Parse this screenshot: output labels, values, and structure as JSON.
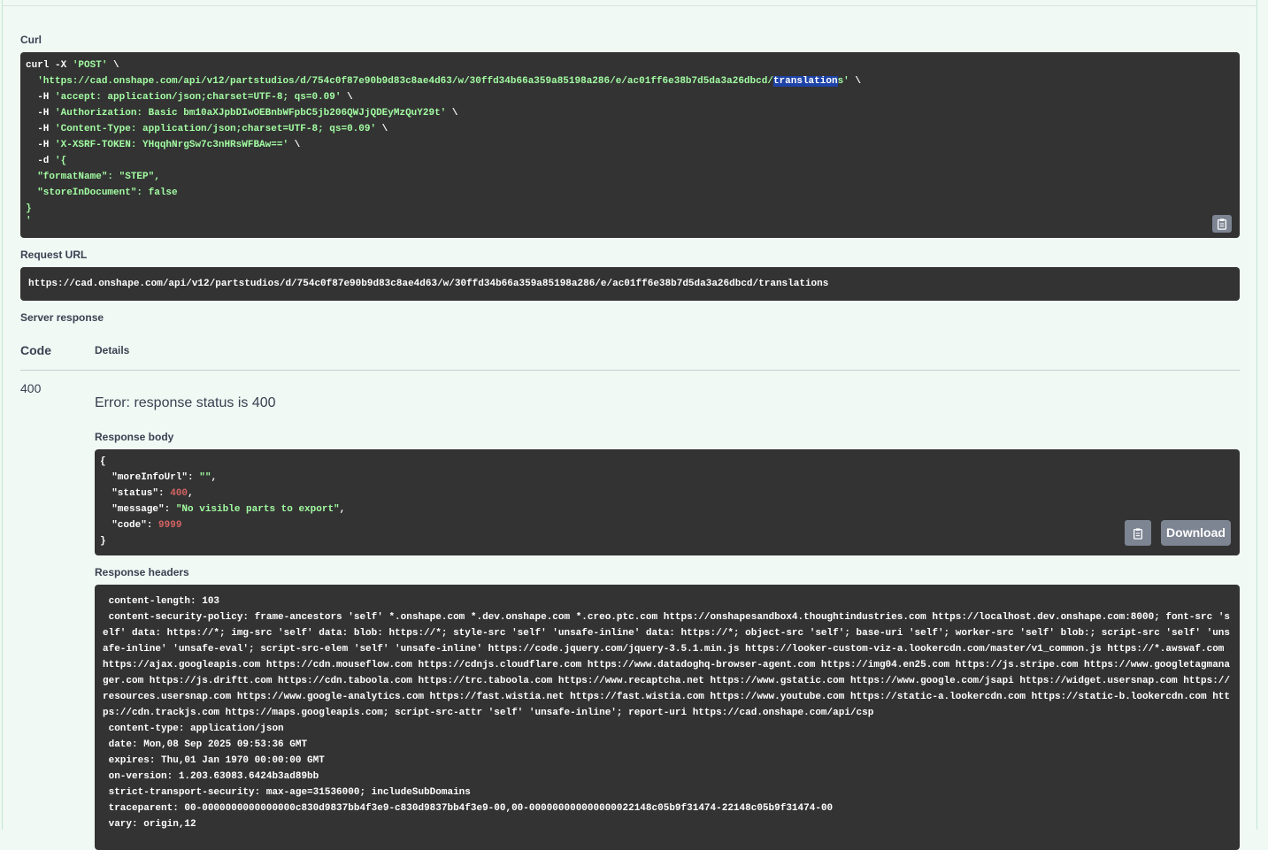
{
  "curl": {
    "label": "Curl",
    "line1": "curl -X ",
    "method": "'POST'",
    "cont": " \\",
    "url_pre": "  'https://cad.onshape.com/api/v12/partstudios/d/754c0f87e90b9d83c8ae4d63/w/30ffd34b66a359a85198a286/e/ac01ff6e38b7d5da3a26dbcd/",
    "url_hl": "translation",
    "url_post": "s'",
    "h1_flag": "  -H ",
    "h1": "'accept: application/json;charset=UTF-8; qs=0.09'",
    "h2_flag": "  -H ",
    "h2": "'Authorization: Basic bm10aXJpbDIwOEBnbWFpbC5jb206QWJjQDEyMzQuY29t'",
    "h3_flag": "  -H ",
    "h3": "'Content-Type: application/json;charset=UTF-8; qs=0.09'",
    "h4_flag": "  -H ",
    "h4": "'X-XSRF-TOKEN: YHqqhNrgSw7c3nHRsWFBAw=='",
    "d_flag": "  -d ",
    "d_open": "'{",
    "b1": "  \"formatName\": \"STEP\",",
    "b2": "  \"storeInDocument\": false",
    "b3": "}",
    "b4": "'"
  },
  "request_url": {
    "label": "Request URL",
    "value": "https://cad.onshape.com/api/v12/partstudios/d/754c0f87e90b9d83c8ae4d63/w/30ffd34b66a359a85198a286/e/ac01ff6e38b7d5da3a26dbcd/translations"
  },
  "server_response": {
    "label": "Server response",
    "col_code": "Code",
    "col_details": "Details",
    "code": "400",
    "error": "Error: response status is 400",
    "body_label": "Response body",
    "body": {
      "open": "{",
      "k1": "  \"moreInfoUrl\"",
      "v1": "\"\"",
      "k2": "  \"status\"",
      "v2": "400",
      "k3": "  \"message\"",
      "v3": "\"No visible parts to export\"",
      "k4": "  \"code\"",
      "v4": "9999",
      "close": "}"
    },
    "download": "Download",
    "headers_label": "Response headers",
    "headers": [
      " content-length: 103",
      " content-security-policy: frame-ancestors 'self' *.onshape.com *.dev.onshape.com *.creo.ptc.com https://onshapesandbox4.thoughtindustries.com https://localhost.dev.onshape.com:8000; font-src 'self' data: https://*; img-src 'self' data: blob: https://*; style-src 'self' 'unsafe-inline' data: https://*; object-src 'self'; base-uri 'self'; worker-src 'self' blob:; script-src 'self' 'unsafe-inline' 'unsafe-eval'; script-src-elem 'self' 'unsafe-inline' https://code.jquery.com/jquery-3.5.1.min.js https://looker-custom-viz-a.lookercdn.com/master/v1_common.js https://*.awswaf.com https://ajax.googleapis.com https://cdn.mouseflow.com https://cdnjs.cloudflare.com https://www.datadoghq-browser-agent.com https://img04.en25.com https://js.stripe.com https://www.googletagmanager.com https://js.driftt.com https://cdn.taboola.com https://trc.taboola.com https://www.recaptcha.net https://www.gstatic.com https://www.google.com/jsapi https://widget.usersnap.com https://resources.usersnap.com https://www.google-analytics.com https://fast.wistia.net https://fast.wistia.com https://www.youtube.com https://static-a.lookercdn.com https://static-b.lookercdn.com https://cdn.trackjs.com https://maps.googleapis.com; script-src-attr 'self' 'unsafe-inline'; report-uri https://cad.onshape.com/api/csp",
      " content-type: application/json",
      " date: Mon,08 Sep 2025 09:53:36 GMT",
      " expires: Thu,01 Jan 1970 00:00:00 GMT",
      " on-version: 1.203.63083.6424b3ad89bb",
      " strict-transport-security: max-age=31536000; includeSubDomains",
      " traceparent: 00-0000000000000000c830d9837bb4f3e9-c830d9837bb4f3e9-00,00-000000000000000022148c05b9f31474-22148c05b9f31474-00",
      " vary: origin,12"
    ]
  },
  "icons": {
    "copy": "clipboard-icon"
  }
}
